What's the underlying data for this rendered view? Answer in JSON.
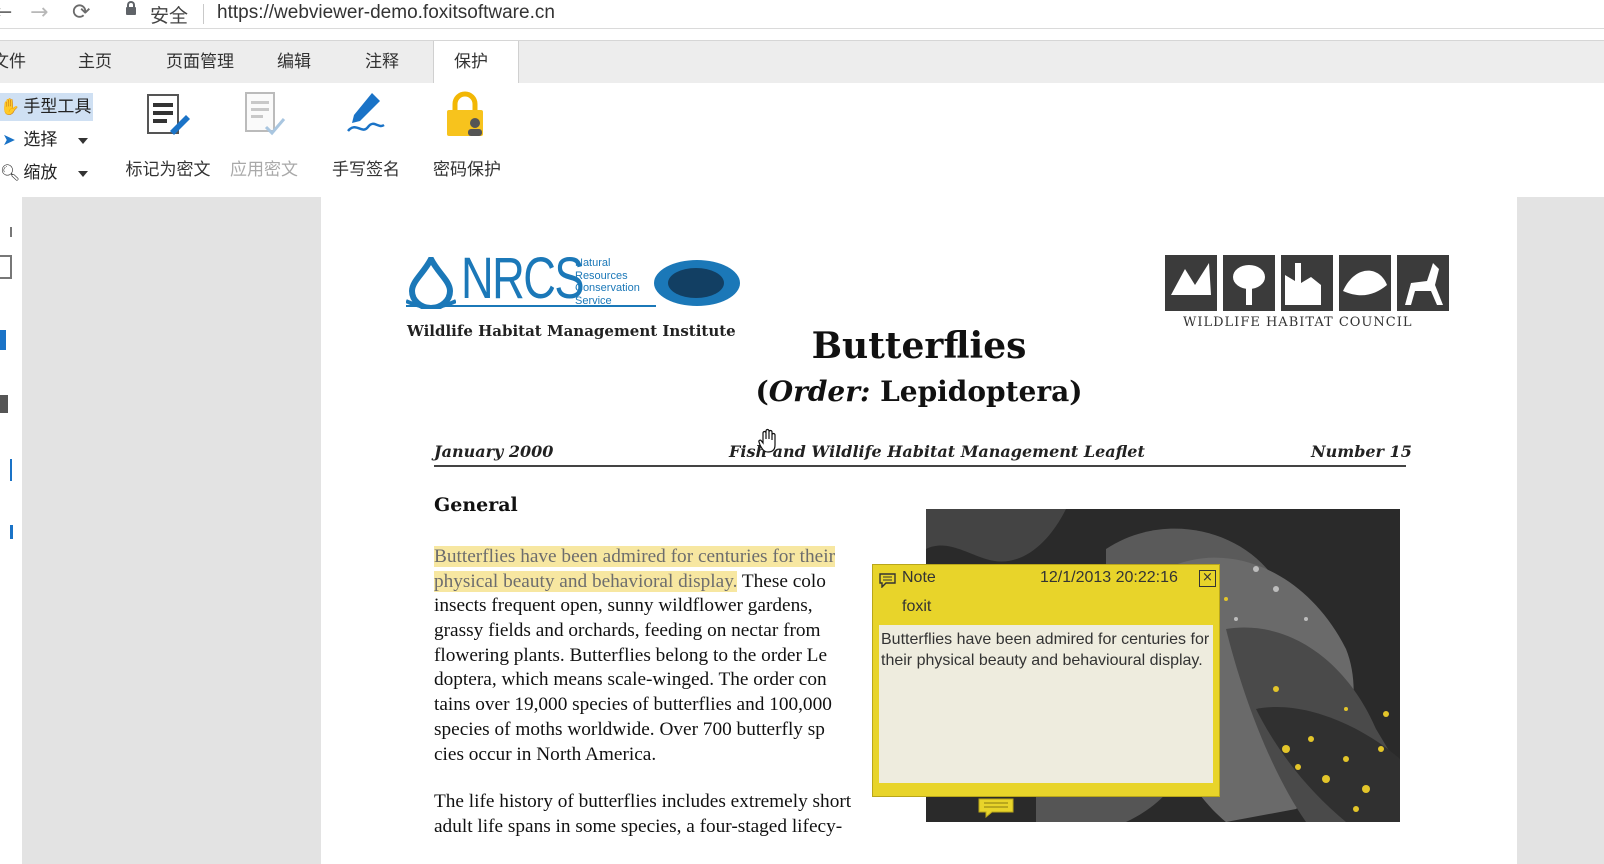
{
  "browser": {
    "security_label": "安全",
    "url": "https://webviewer-demo.foxitsoftware.cn"
  },
  "tabs": [
    {
      "label": "文件"
    },
    {
      "label": "主页"
    },
    {
      "label": "页面管理"
    },
    {
      "label": "编辑"
    },
    {
      "label": "注释"
    },
    {
      "label": "保护",
      "active": true
    }
  ],
  "tools": {
    "hand": "手型工具",
    "select": "选择",
    "zoom": "缩放"
  },
  "ribbon": {
    "mark_redact": "标记为密文",
    "apply_redact": "应用密文",
    "handwriting_sign": "手写签名",
    "password_protect": "密码保护"
  },
  "document": {
    "nrcs_logo": "NRCS",
    "nrcs_sub": "Natural Resources Conservation Service",
    "whmi": "Wildlife Habitat Management Institute",
    "whc": "WILDLIFE HABITAT COUNCIL",
    "title": "Butterflies",
    "subtitle_order": "Order:",
    "subtitle_name": "Lepidoptera",
    "date": "January 2000",
    "series": "Fish and Wildlife Habitat Management Leaflet",
    "number": "Number 15",
    "section": "General",
    "para1_lines": [
      "Butterflies have been admired for centuries for their",
      "physical beauty and behavioral display.",
      "insects frequent open, sunny wildflower gardens,",
      "grassy fields and orchards, feeding on nectar from",
      "flowering plants.  Butterflies belong to the order Le",
      "doptera, which means scale-winged.  The order con",
      "tains over 19,000 species of butterflies and 100,000",
      "species of moths worldwide.  Over 700 butterfly sp",
      "cies occur in North America."
    ],
    "para1_line2_tail": " These colo",
    "para2_lines": [
      "The life history of butterflies includes extremely short",
      "adult life spans in some species, a four-staged lifecy-"
    ]
  },
  "note": {
    "type": "Note",
    "date": "12/1/2013 20:22:16",
    "author": "foxit",
    "body": "Butterflies have been admired for centuries for their physical beauty and behavioural display.",
    "close": "×"
  },
  "colors": {
    "accent": "#1a73c7",
    "highlight": "#f7e7a1",
    "note_bg": "#e8d42a"
  }
}
